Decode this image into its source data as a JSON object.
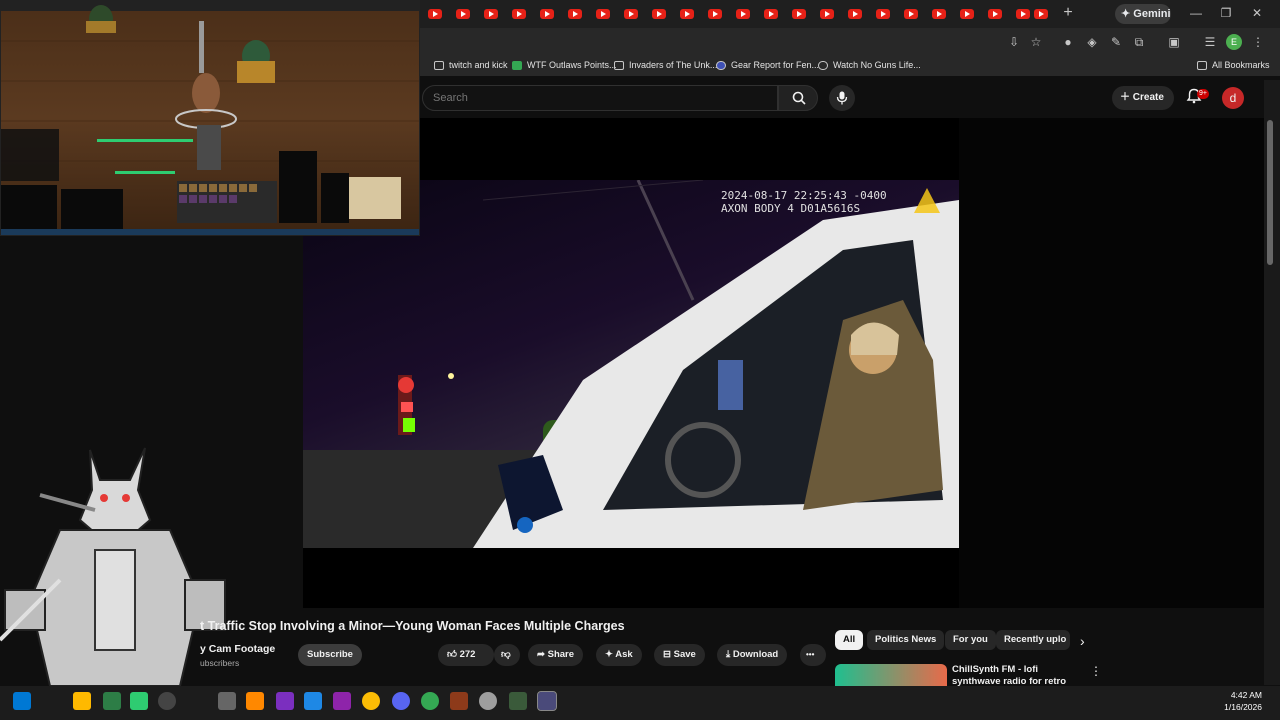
{
  "browser": {
    "gemini_label": "Gemini",
    "new_tab_label": "+",
    "window_controls": {
      "minimize": "—",
      "restore": "❐",
      "close": "✕"
    },
    "bookmarks": [
      "twitch and kick",
      "WTF Outlaws Points...",
      "Invaders of The Unk...",
      "Gear Report for Fen...",
      "Watch No Guns Life...",
      "All Bookmarks"
    ]
  },
  "youtube": {
    "search_placeholder": "Search",
    "create_label": "Create",
    "notifications_badge": "9+",
    "avatar_letter": "d"
  },
  "video": {
    "timestamp_line1": "2024-08-17 22:25:43 -0400",
    "timestamp_line2": "AXON BODY 4 D01A5616S",
    "title": "t Traffic Stop Involving a Minor—Young Woman Faces Multiple Charges",
    "channel": "y Cam Footage",
    "subscribers": "ubscribers",
    "subscribe_label": "Subscribe",
    "like_count": "272",
    "share_label": "Share",
    "ask_label": "Ask",
    "save_label": "Save",
    "download_label": "Download",
    "more_label": "•••"
  },
  "sidebar": {
    "chips": [
      "All",
      "Politics News",
      "For you",
      "Recently uplo"
    ],
    "recommendation": {
      "title": "ChillSynth FM - lofi synthwave radio for retro dreaming",
      "menu": "⋮"
    }
  },
  "taskbar": {
    "time": "4:42 AM",
    "date": "1/16/2026"
  },
  "colors": {
    "yt_red": "#e62117",
    "background": "#0f0f0f"
  }
}
